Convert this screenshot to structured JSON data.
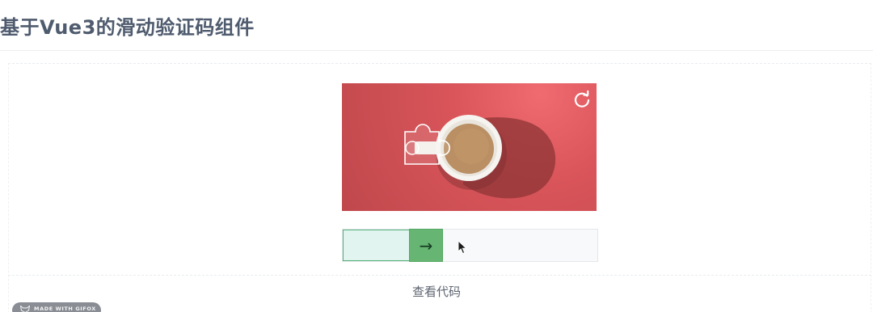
{
  "page": {
    "title": "基于Vue3的滑动验证码组件",
    "view_code_label": "查看代码"
  },
  "captcha": {
    "image_subject": "coffee cup on red background",
    "refresh_icon": "refresh-icon",
    "slider_icon": "arrow-right-icon",
    "slider_arrow": "→",
    "slider_progress": 0.395,
    "accent_color": "#66b573",
    "track_fill_color": "#e2f4f0",
    "background_color": "#d9555a"
  },
  "watermark": {
    "label": "MADE WITH GIFOX"
  }
}
